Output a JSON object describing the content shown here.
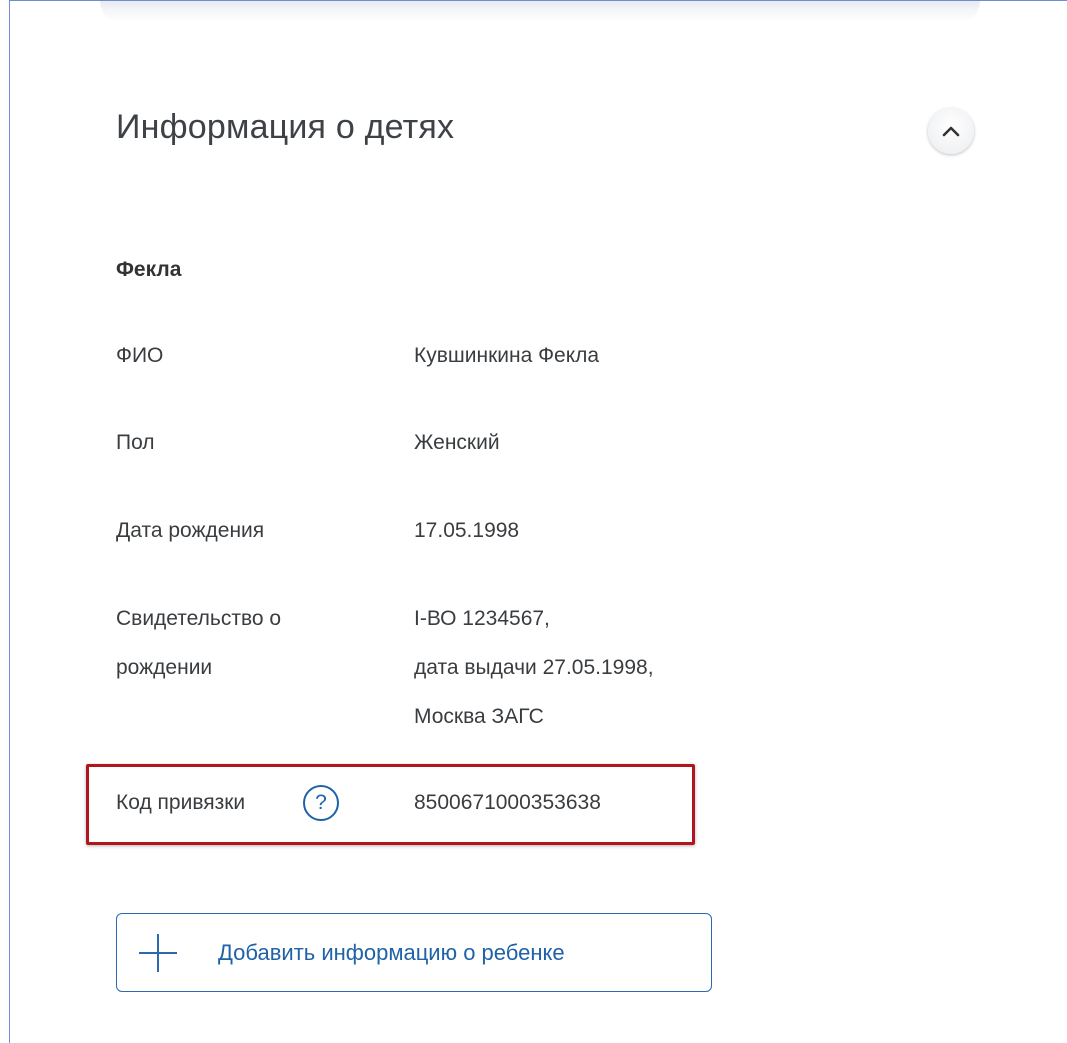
{
  "section": {
    "title": "Информация о детях",
    "collapse_icon": "chevron-up-icon"
  },
  "child": {
    "name": "Фекла",
    "fields": [
      {
        "label": "ФИО",
        "value": "Кувшинкина Фекла"
      },
      {
        "label": "Пол",
        "value": "Женский"
      },
      {
        "label": "Дата рождения",
        "value": "17.05.1998"
      },
      {
        "label_lines": [
          "Свидетельство о",
          "рождении"
        ],
        "value_lines": [
          "I-ВО 1234567,",
          "дата выдачи 27.05.1998,",
          "Москва ЗАГС"
        ]
      }
    ],
    "binding_code": {
      "label": "Код привязки",
      "help_symbol": "?",
      "value": "8500671000353638"
    }
  },
  "add_button": {
    "label": "Добавить информацию о ребенке",
    "icon": "plus-icon"
  },
  "colors": {
    "accent": "#1f62a8",
    "highlight_border": "#b0161e",
    "text": "#3a3d40"
  }
}
